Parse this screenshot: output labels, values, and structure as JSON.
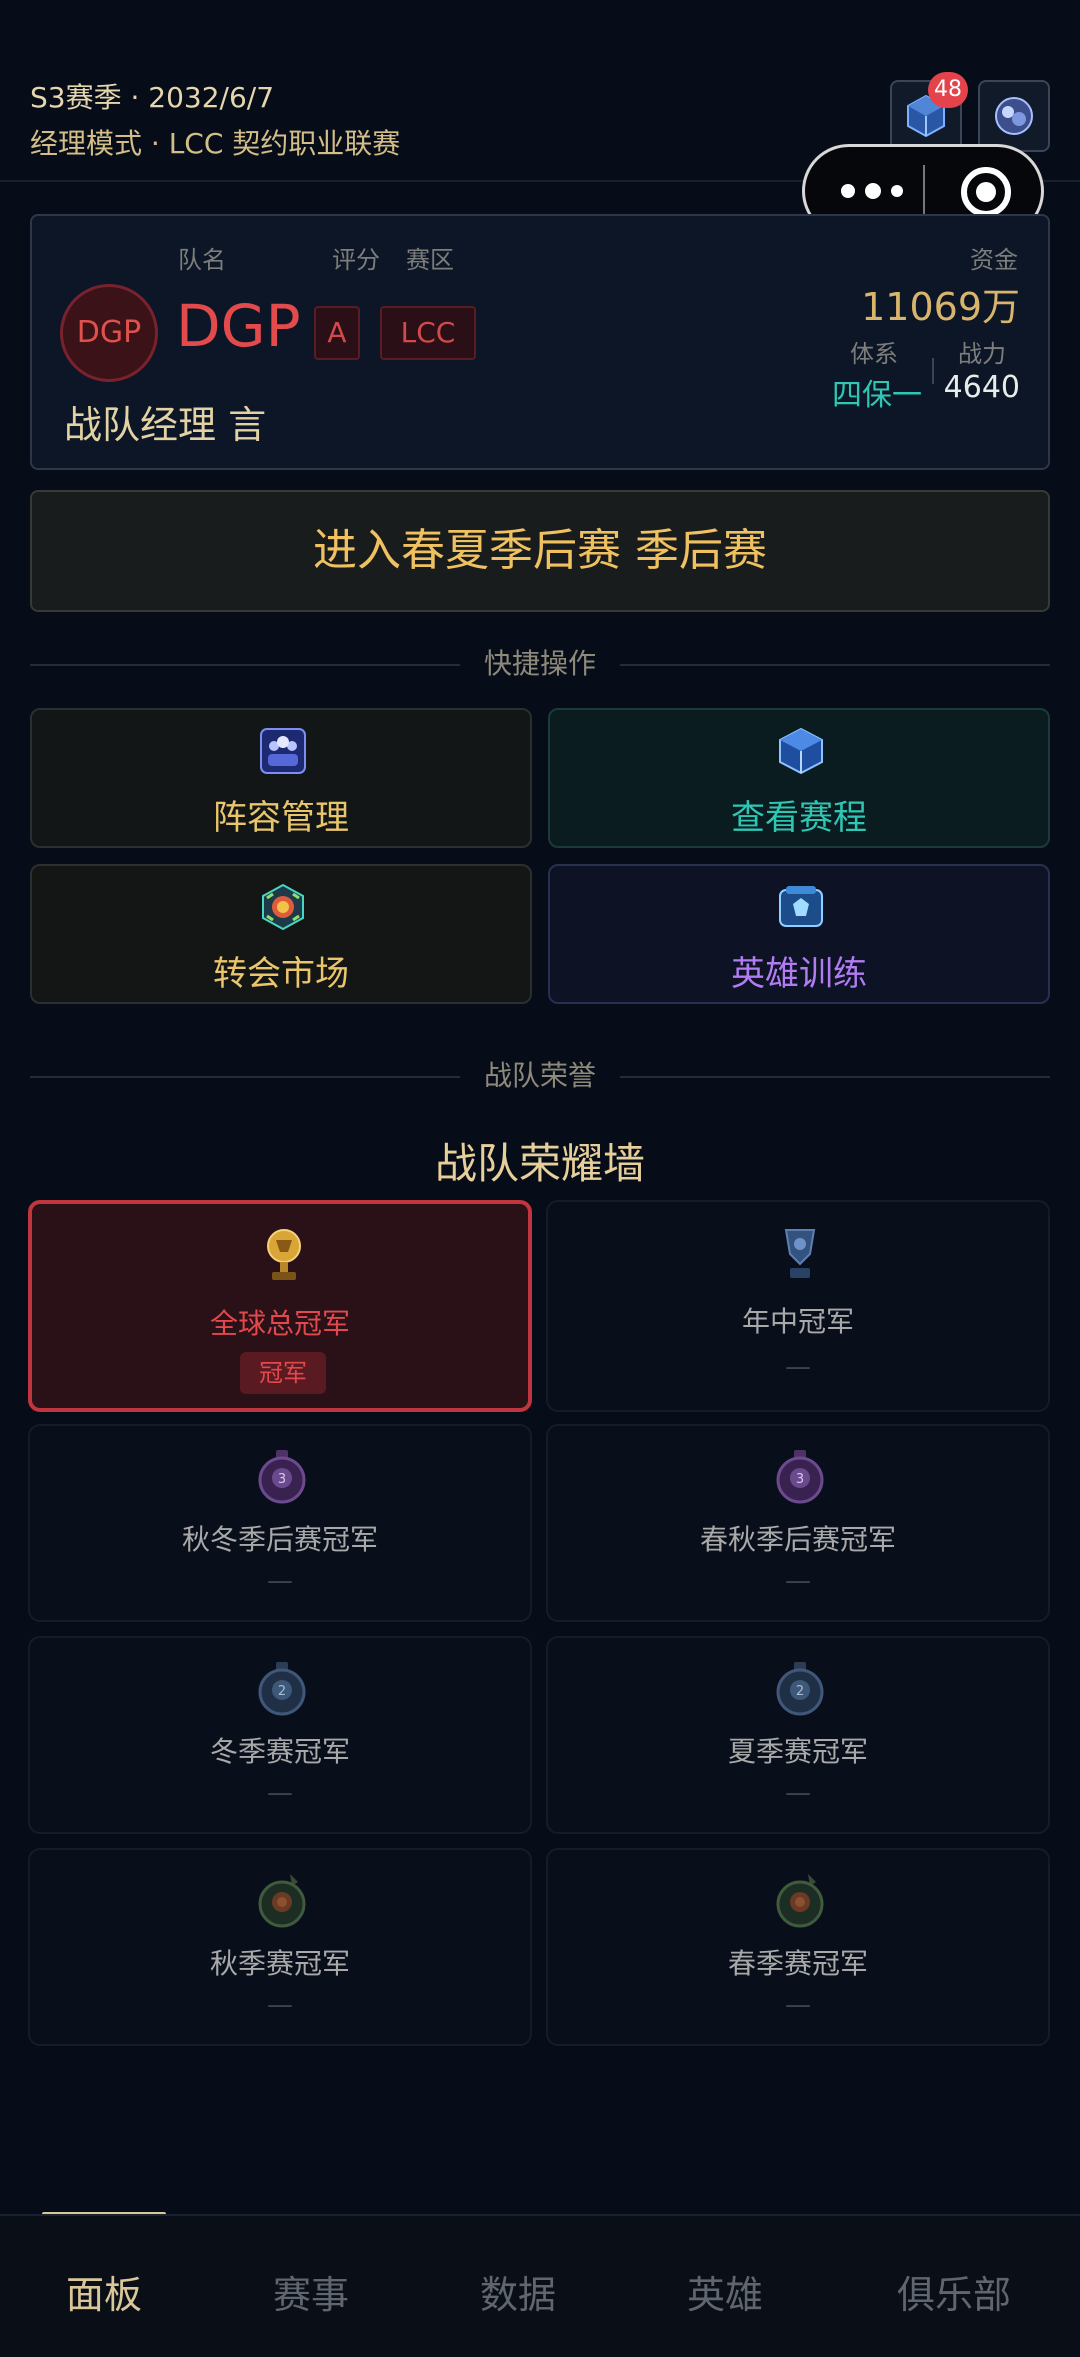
{
  "header": {
    "season": "S3赛季 · 2032/6/7",
    "mode": "经理模式 · LCC 契约职业联赛",
    "notification_count": "48"
  },
  "team": {
    "labels": {
      "name": "队名",
      "rating": "评分",
      "region": "赛区",
      "funds": "资金",
      "system": "体系",
      "power": "战力"
    },
    "logo_text": "DGP",
    "name": "DGP",
    "rating": "A",
    "region": "LCC",
    "manager_label": "战队经理",
    "manager_name": "言",
    "funds": "11069万",
    "system": "四保一",
    "power": "4640"
  },
  "advance_button": "进入春夏季后赛 季后赛",
  "sections": {
    "quick_actions": "快捷操作",
    "team_honors": "战队荣誉"
  },
  "quick_actions": [
    {
      "label": "阵容管理",
      "icon": "lineup-icon"
    },
    {
      "label": "查看赛程",
      "icon": "schedule-icon"
    },
    {
      "label": "转会市场",
      "icon": "transfer-market-icon"
    },
    {
      "label": "英雄训练",
      "icon": "hero-training-icon"
    }
  ],
  "honor_wall": {
    "title": "战队荣耀墙",
    "items": [
      {
        "name": "全球总冠军",
        "status": "冠军",
        "won": true
      },
      {
        "name": "年中冠军",
        "status": "—",
        "won": false
      },
      {
        "name": "秋冬季后赛冠军",
        "status": "—",
        "won": false
      },
      {
        "name": "春秋季后赛冠军",
        "status": "—",
        "won": false
      },
      {
        "name": "冬季赛冠军",
        "status": "—",
        "won": false
      },
      {
        "name": "夏季赛冠军",
        "status": "—",
        "won": false
      },
      {
        "name": "秋季赛冠军",
        "status": "—",
        "won": false
      },
      {
        "name": "春季赛冠军",
        "status": "—",
        "won": false
      }
    ]
  },
  "tabs": [
    {
      "label": "面板",
      "active": true
    },
    {
      "label": "赛事",
      "active": false
    },
    {
      "label": "数据",
      "active": false
    },
    {
      "label": "英雄",
      "active": false
    },
    {
      "label": "俱乐部",
      "active": false
    }
  ],
  "colors": {
    "background": "#070d18",
    "gold": "#d9c79a",
    "team_red": "#e24a4c",
    "teal": "#2fc6b4",
    "purple": "#b07cf2",
    "amber": "#f0c161"
  }
}
